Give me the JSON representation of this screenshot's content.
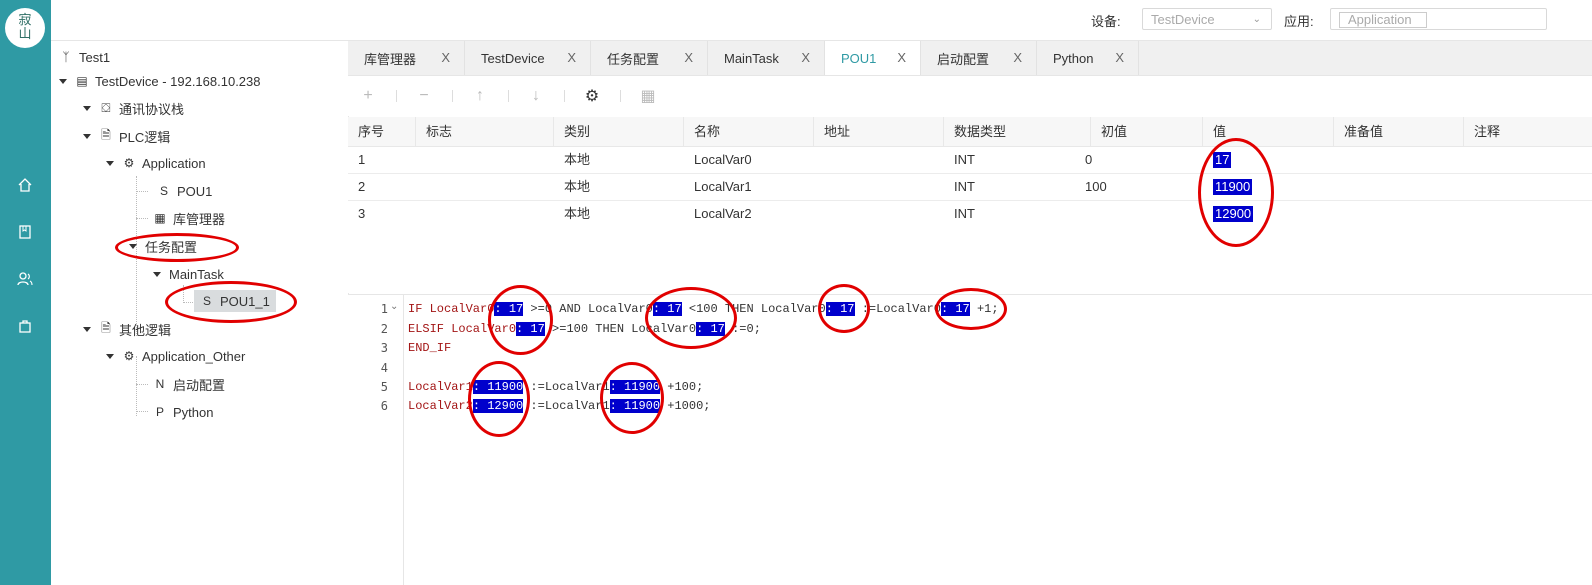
{
  "logo": {
    "line1": "寂",
    "line2": "山"
  },
  "rail": {
    "icons": [
      "home-icon",
      "book-icon",
      "users-icon",
      "bag-icon"
    ]
  },
  "topbar": {
    "device_label": "设备:",
    "device_value": "TestDevice",
    "app_label": "应用:",
    "app_value": "Application"
  },
  "tree": {
    "root": "Test1",
    "device": "TestDevice - 192.168.10.238",
    "comm": "通讯协议栈",
    "plc": "PLC逻辑",
    "application": "Application",
    "pou1_prefix": "S",
    "pou1": "POU1",
    "libmgr": "库管理器",
    "taskcfg": "任务配置",
    "maintask": "MainTask",
    "pou1_1_prefix": "S",
    "pou1_1": "POU1_1",
    "other": "其他逻辑",
    "app_other": "Application_Other",
    "startup_prefix": "N",
    "startup": "启动配置",
    "python_prefix": "P",
    "python": "Python"
  },
  "tabs": [
    {
      "label": "库管理器"
    },
    {
      "label": "TestDevice"
    },
    {
      "label": "任务配置"
    },
    {
      "label": "MainTask"
    },
    {
      "label": "POU1"
    },
    {
      "label": "启动配置"
    },
    {
      "label": "Python"
    }
  ],
  "tab_close": "X",
  "table": {
    "headers": [
      "序号",
      "标志",
      "类别",
      "名称",
      "地址",
      "数据类型",
      "初值",
      "值",
      "准备值",
      "注释"
    ],
    "rows": [
      {
        "no": "1",
        "cat": "本地",
        "name": "LocalVar0",
        "type": "INT",
        "init": "0",
        "value": "17"
      },
      {
        "no": "2",
        "cat": "本地",
        "name": "LocalVar1",
        "type": "INT",
        "init": "100",
        "value": "11900"
      },
      {
        "no": "3",
        "cat": "本地",
        "name": "LocalVar2",
        "type": "INT",
        "init": "",
        "value": "12900"
      }
    ]
  },
  "editor": {
    "line_numbers": [
      "1",
      "2",
      "3",
      "4",
      "5",
      "6"
    ],
    "l1": {
      "a": "IF LocalVar0",
      "v1": ": 17",
      "b": " >=0 AND LocalVar0",
      "v2": ": 17",
      "c": " <100 THEN LocalVar0",
      "v3": ": 17",
      "d": " :=LocalVar0",
      "v4": ": 17",
      "e": " +1;"
    },
    "l2": {
      "a": "ELSIF LocalVar0",
      "v1": ": 17",
      "b": " >=100 THEN LocalVar0",
      "v2": ": 17",
      "c": " :=0;"
    },
    "l3": "END_IF",
    "l5": {
      "a": "LocalVar1",
      "v1": ": 11900",
      "b": " :=LocalVar1",
      "v2": ": 11900",
      "c": " +100;"
    },
    "l6": {
      "a": "LocalVar2",
      "v1": ": 12900",
      "b": " :=LocalVar1",
      "v2": ": 11900",
      "c": " +1000;"
    }
  },
  "colors": {
    "rail": "#2f9aa4",
    "accent": "#2f9aa4",
    "highlight": "#0000cc",
    "annotation": "#e10000"
  }
}
